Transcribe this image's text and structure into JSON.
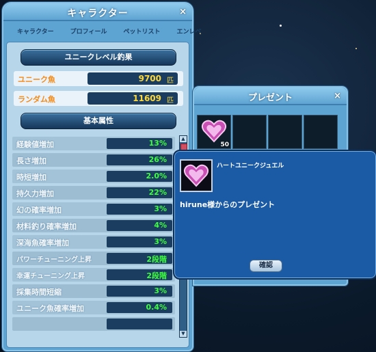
{
  "character_window": {
    "title": "キャラクター",
    "close_label": "×",
    "tabs": [
      "キャラクター",
      "プロフィール",
      "ペットリスト",
      "エンレベ"
    ],
    "unique_section_label": "ユニークレベル釣果",
    "money_rows": [
      {
        "label": "ユニーク魚",
        "value": "9700",
        "unit": "匹"
      },
      {
        "label": "ランダム魚",
        "value": "11609",
        "unit": "匹"
      }
    ],
    "attributes_section_label": "基本属性",
    "attributes": [
      {
        "label": "経験値増加",
        "value": "13%"
      },
      {
        "label": "長さ増加",
        "value": "26%"
      },
      {
        "label": "時短増加",
        "value": "2.0%"
      },
      {
        "label": "持久力増加",
        "value": "22%"
      },
      {
        "label": "幻の確率増加",
        "value": "3%"
      },
      {
        "label": "材料釣り確率増加",
        "value": "4%"
      },
      {
        "label": "深海魚確率増加",
        "value": "3%"
      },
      {
        "label": "パワーチューニング上昇",
        "value": "2段階"
      },
      {
        "label": "幸運チューニング上昇",
        "value": "2段階"
      },
      {
        "label": "採集時間短縮",
        "value": "3%"
      },
      {
        "label": "ユニーク魚確率増加",
        "value": "0.4%"
      },
      {
        "label": "",
        "value": ""
      }
    ],
    "scroll_up": "▲",
    "scroll_down": "▼"
  },
  "present_window": {
    "title": "プレゼント",
    "close_label": "×",
    "first_slot_count": "50"
  },
  "detail_popup": {
    "item_name": "ハートユニークジュエル",
    "from_text": "hirune様からのプレゼント",
    "confirm_label": "確認"
  },
  "colors": {
    "window_blue": "#5ea4d2",
    "orange_label": "#f58a18",
    "yellow_value": "#ffd93a",
    "green_value": "#3dff3d",
    "popup_blue": "#1b5aa5"
  }
}
